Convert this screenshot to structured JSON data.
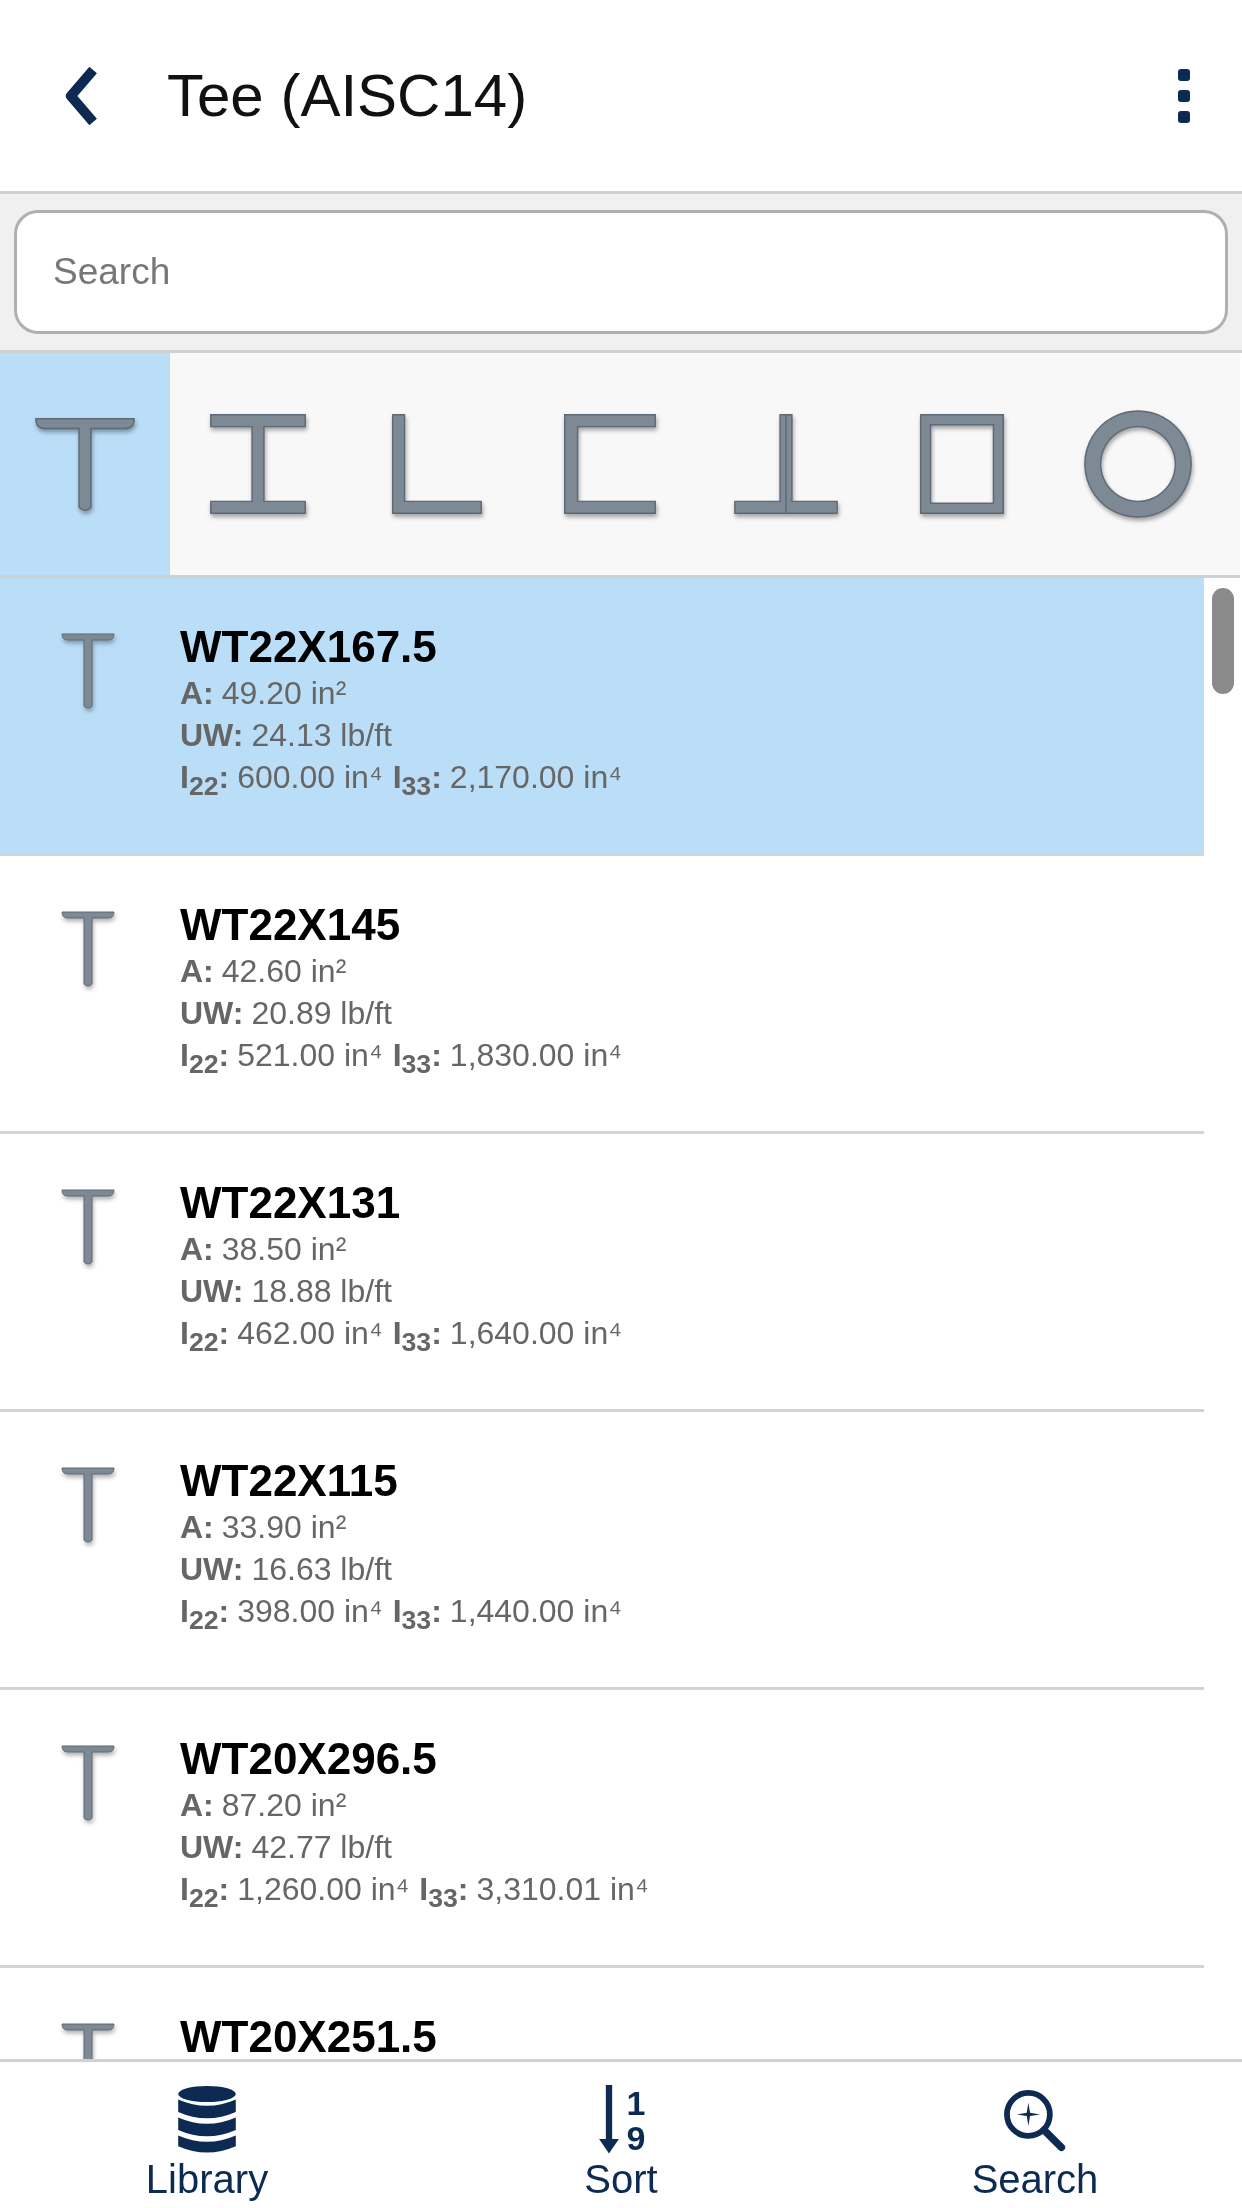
{
  "header": {
    "title": "Tee (AISC14)"
  },
  "search": {
    "placeholder": "Search"
  },
  "shapes": [
    {
      "kind": "tee",
      "selected": true
    },
    {
      "kind": "wide-flange",
      "selected": false
    },
    {
      "kind": "angle",
      "selected": false
    },
    {
      "kind": "channel",
      "selected": false
    },
    {
      "kind": "double-angle",
      "selected": false
    },
    {
      "kind": "box",
      "selected": false
    },
    {
      "kind": "pipe",
      "selected": false
    }
  ],
  "rows": [
    {
      "name": "WT22X167.5",
      "selected": true,
      "lines": [
        [
          {
            "label": "A:",
            "value": "49.20 in²"
          }
        ],
        [
          {
            "label": "UW:",
            "value": "24.13 lb/ft"
          }
        ],
        [
          {
            "label": "I$_{22}$:",
            "value": "600.00 in⁴"
          },
          {
            "label": "I$_{33}$:",
            "value": "2,170.00 in⁴"
          }
        ]
      ]
    },
    {
      "name": "WT22X145",
      "selected": false,
      "lines": [
        [
          {
            "label": "A:",
            "value": "42.60 in²"
          }
        ],
        [
          {
            "label": "UW:",
            "value": "20.89 lb/ft"
          }
        ],
        [
          {
            "label": "I$_{22}$:",
            "value": "521.00 in⁴"
          },
          {
            "label": "I$_{33}$:",
            "value": "1,830.00 in⁴"
          }
        ]
      ]
    },
    {
      "name": "WT22X131",
      "selected": false,
      "lines": [
        [
          {
            "label": "A:",
            "value": "38.50 in²"
          }
        ],
        [
          {
            "label": "UW:",
            "value": "18.88 lb/ft"
          }
        ],
        [
          {
            "label": "I$_{22}$:",
            "value": "462.00 in⁴"
          },
          {
            "label": "I$_{33}$:",
            "value": "1,640.00 in⁴"
          }
        ]
      ]
    },
    {
      "name": "WT22X115",
      "selected": false,
      "lines": [
        [
          {
            "label": "A:",
            "value": "33.90 in²"
          }
        ],
        [
          {
            "label": "UW:",
            "value": "16.63 lb/ft"
          }
        ],
        [
          {
            "label": "I$_{22}$:",
            "value": "398.00 in⁴"
          },
          {
            "label": "I$_{33}$:",
            "value": "1,440.00 in⁴"
          }
        ]
      ]
    },
    {
      "name": "WT20X296.5",
      "selected": false,
      "lines": [
        [
          {
            "label": "A:",
            "value": "87.20 in²"
          }
        ],
        [
          {
            "label": "UW:",
            "value": "42.77 lb/ft"
          }
        ],
        [
          {
            "label": "I$_{22}$:",
            "value": "1,260.00 in⁴"
          },
          {
            "label": "I$_{33}$:",
            "value": "3,310.01 in⁴"
          }
        ]
      ]
    },
    {
      "name": "WT20X251.5",
      "selected": false
    }
  ],
  "nav": [
    {
      "kind": "database",
      "label": "Library"
    },
    {
      "kind": "sort",
      "label": "Sort",
      "glyphs": [
        "1",
        "9"
      ]
    },
    {
      "kind": "search",
      "label": "Search"
    }
  ]
}
